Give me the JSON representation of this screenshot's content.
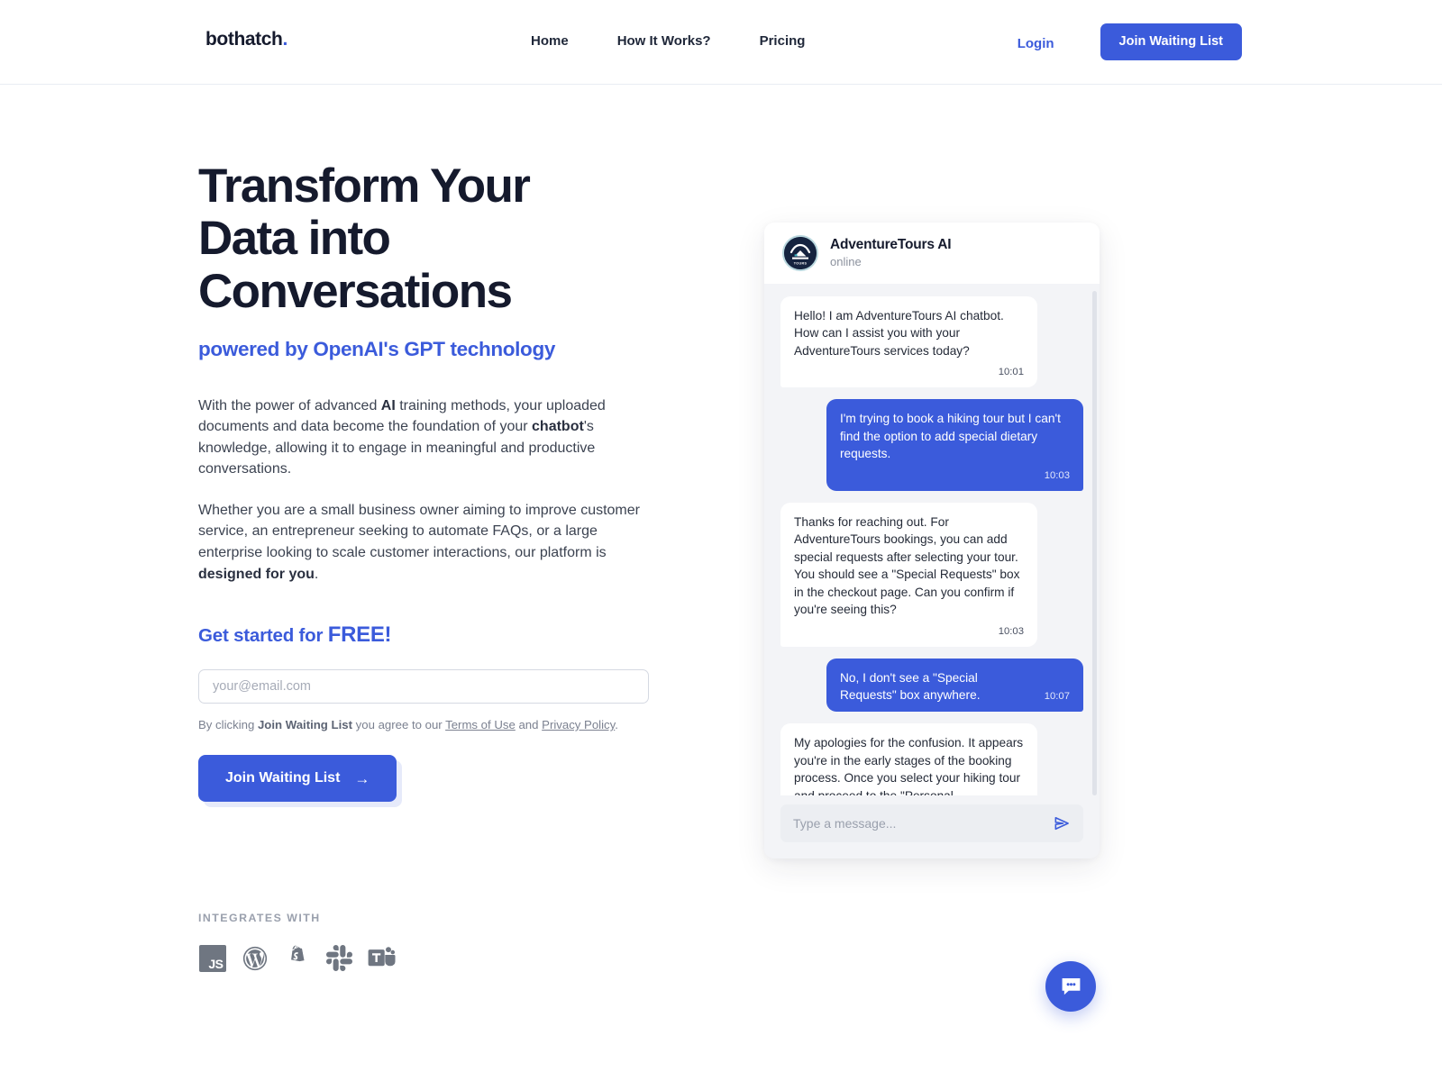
{
  "header": {
    "logo_text": "bothatch",
    "logo_dot": ".",
    "nav": [
      {
        "label": "Home"
      },
      {
        "label": "How It Works?"
      },
      {
        "label": "Pricing"
      }
    ],
    "login_label": "Login",
    "join_label": "Join Waiting List"
  },
  "hero": {
    "headline": "Transform Your Data into Conversations",
    "subheadline": "powered by OpenAI's GPT technology",
    "paragraph1": {
      "part1": "With the power of advanced ",
      "bold1": "AI",
      "part2": " training methods, your uploaded documents and data become the foundation of your ",
      "bold2": "chatbot",
      "part3": "'s knowledge, allowing it to engage in meaningful and productive conversations."
    },
    "paragraph2": {
      "part1": "Whether you are a small business owner aiming to improve customer service, an entrepreneur seeking to automate FAQs, or a large enterprise looking to scale customer interactions, our platform is ",
      "bold1": "designed for you",
      "part2": "."
    },
    "cta_heading": "Get started for ",
    "cta_heading_free": "FREE!",
    "email_placeholder": "your@email.com",
    "email_value": "",
    "terms": {
      "part1": "By clicking ",
      "bold1": "Join Waiting List",
      "part2": " you agree to our ",
      "link1": "Terms of Use",
      "part3": " and ",
      "link2": "Privacy Policy",
      "part4": "."
    },
    "join_button_label": "Join Waiting List",
    "join_button_arrow": "→"
  },
  "integrations": {
    "label": "INTEGRATES WITH",
    "items": [
      {
        "name": "javascript-icon",
        "text": "JS"
      },
      {
        "name": "wordpress-icon",
        "text": ""
      },
      {
        "name": "shopify-icon",
        "text": ""
      },
      {
        "name": "slack-icon",
        "text": ""
      },
      {
        "name": "microsoft-teams-icon",
        "text": ""
      }
    ]
  },
  "chat": {
    "bot_name": "AdventureTours AI",
    "status": "online",
    "avatar_label": "TOURS",
    "messages": [
      {
        "from": "bot",
        "text": "Hello! I am AdventureTours AI chatbot. How can I assist you with your AdventureTours services today?",
        "time": "10:01"
      },
      {
        "from": "user",
        "text": "I'm trying to book a hiking tour but I can't find the option to add special dietary requests.",
        "time": "10:03"
      },
      {
        "from": "bot",
        "text": "Thanks for reaching out. For AdventureTours bookings, you can add special requests after selecting your tour. You should see a \"Special Requests\" box in the checkout page. Can you confirm if you're seeing this?",
        "time": "10:03"
      },
      {
        "from": "user",
        "text": "No, I don't see a \"Special Requests\" box anywhere.",
        "time": "10:07"
      },
      {
        "from": "bot",
        "text": "My apologies for the confusion. It appears you're in the early stages of the booking process. Once you select your hiking tour and proceed to the \"Personal",
        "time": ""
      }
    ],
    "input_placeholder": "Type a message...",
    "input_value": "",
    "send_icon": "send-icon"
  },
  "fab": {
    "icon": "chat-bubble-icon"
  },
  "colors": {
    "accent": "#3b5bdb",
    "headline": "#151a2d",
    "body": "#3c4351",
    "muted": "#7b8190",
    "chat_bg": "#f3f4f7"
  }
}
